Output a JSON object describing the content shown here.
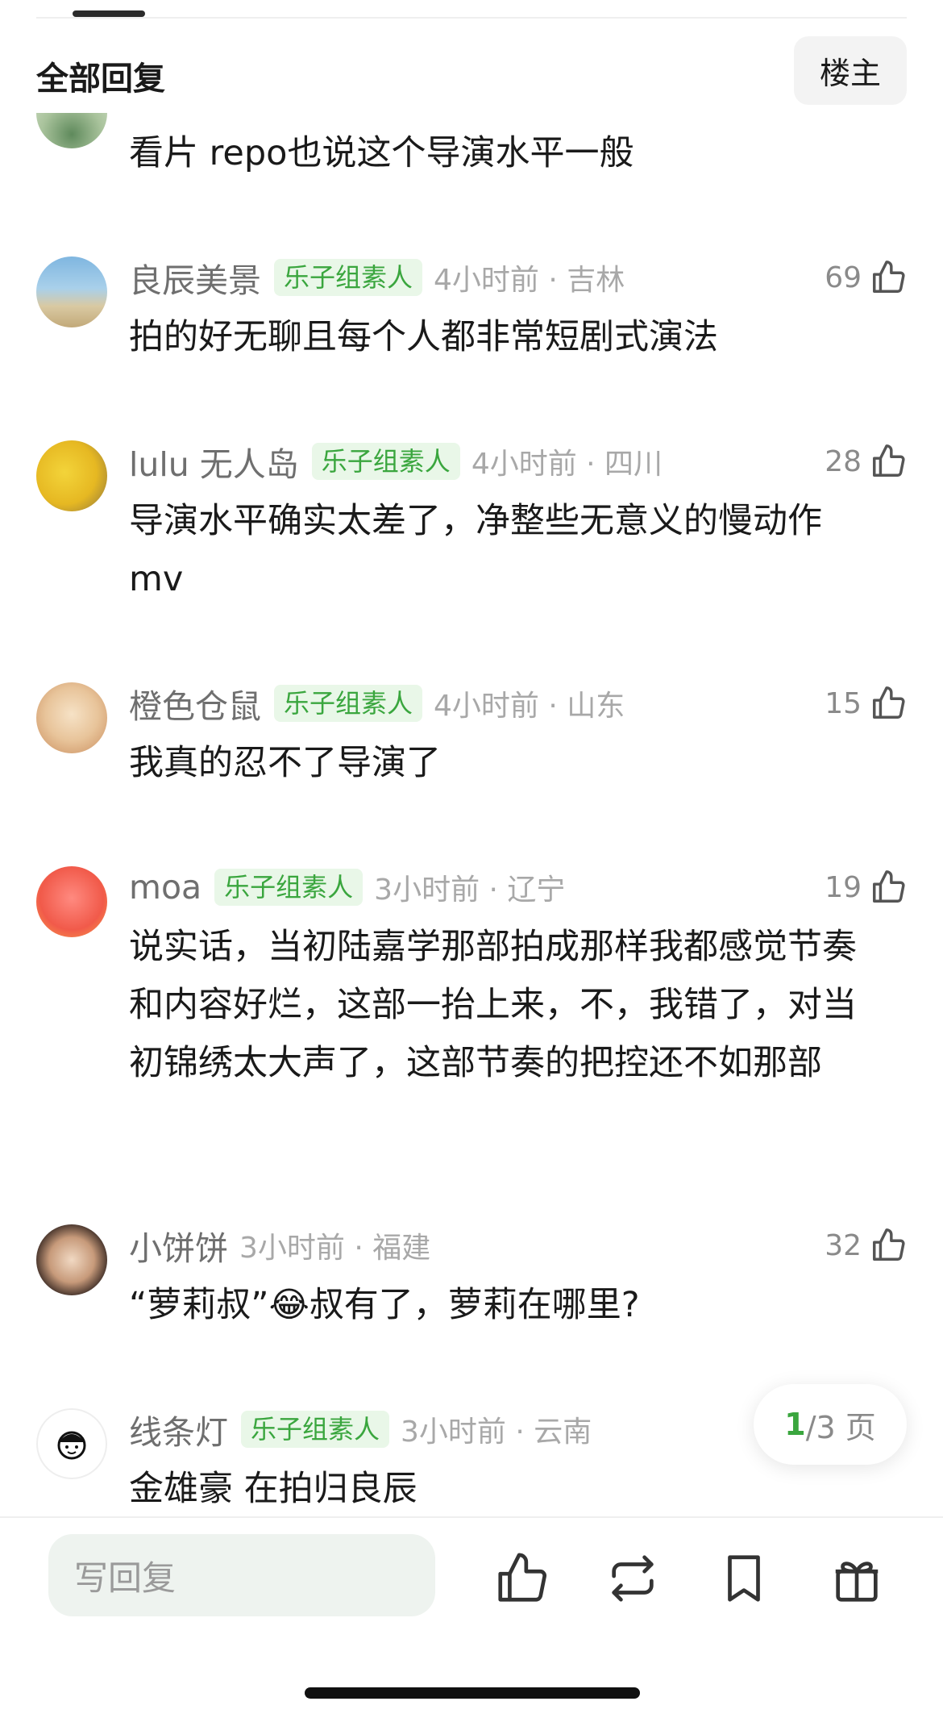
{
  "header": {
    "title": "全部回复",
    "op_filter": "楼主"
  },
  "partial_comment": {
    "text": "看片 repo也说这个导演水平一般"
  },
  "comments": [
    {
      "username": "良辰美景",
      "badge": "乐子组素人",
      "time": "4小时前 · 吉林",
      "likes": "69",
      "text": "拍的好无聊且每个人都非常短剧式演法"
    },
    {
      "username": "lulu 无人岛",
      "badge": "乐子组素人",
      "time": "4小时前 · 四川",
      "likes": "28",
      "text": "导演水平确实太差了，净整些无意义的慢动作 mv"
    },
    {
      "username": "橙色仓鼠",
      "badge": "乐子组素人",
      "time": "4小时前 · 山东",
      "likes": "15",
      "text": "我真的忍不了导演了"
    },
    {
      "username": "moa",
      "badge": "乐子组素人",
      "time": "3小时前 · 辽宁",
      "likes": "19",
      "text": "说实话，当初陆嘉学那部拍成那样我都感觉节奏和内容好烂，这部一抬上来，不，我错了，对当初锦绣太大声了，这部节奏的把控还不如那部"
    },
    {
      "username": "小饼饼",
      "badge": "",
      "time": "3小时前 · 福建",
      "likes": "32",
      "text_before": "“萝莉叔”",
      "emoji": "😂",
      "text_after": "叔有了，萝莉在哪里?"
    },
    {
      "username": "线条灯",
      "badge": "乐子组素人",
      "time": "3小时前 · 云南",
      "likes": "",
      "text": "金雄豪 在拍归良辰"
    }
  ],
  "pager": {
    "current": "1",
    "rest": "/3 页"
  },
  "bottom_bar": {
    "reply_placeholder": "写回复"
  },
  "icons": [
    "thumbs-up-icon",
    "repost-icon",
    "bookmark-icon",
    "gift-icon"
  ],
  "colors": {
    "accent_green": "#3aa63e",
    "badge_bg": "#e9f7e8",
    "meta_gray": "#a8a8a8"
  }
}
